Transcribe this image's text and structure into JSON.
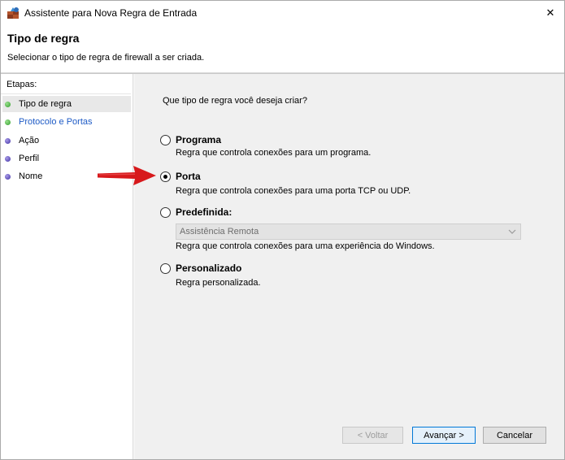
{
  "window": {
    "title": "Assistente para Nova Regra de Entrada",
    "icon": "firewall-app-icon",
    "close_glyph": "✕"
  },
  "header": {
    "title": "Tipo de regra",
    "subtitle": "Selecionar o tipo de regra de firewall a ser criada."
  },
  "sidebar": {
    "heading": "Etapas:",
    "steps": [
      {
        "label": "Tipo de regra",
        "status": "done",
        "active": true
      },
      {
        "label": "Protocolo e Portas",
        "status": "done",
        "active": false
      },
      {
        "label": "Ação",
        "status": "pending",
        "active": false
      },
      {
        "label": "Perfil",
        "status": "pending",
        "active": false
      },
      {
        "label": "Nome",
        "status": "pending",
        "active": false
      }
    ]
  },
  "main": {
    "question": "Que tipo de regra você deseja criar?",
    "options": [
      {
        "label": "Programa",
        "description": "Regra que controla conexões para um programa.",
        "selected": false
      },
      {
        "label": "Porta",
        "description": "Regra que controla conexões para uma porta TCP ou UDP.",
        "selected": true
      },
      {
        "label": "Predefinida:",
        "description": "Regra que controla conexões para uma experiência do Windows.",
        "selected": false
      },
      {
        "label": "Personalizado",
        "description": "Regra personalizada.",
        "selected": false
      }
    ],
    "predefined_select": {
      "value": "Assistência Remota",
      "disabled": true
    }
  },
  "buttons": {
    "back": "< Voltar",
    "next": "Avançar >",
    "cancel": "Cancelar"
  },
  "annotation": {
    "icon": "red-arrow-icon",
    "color": "#d7191c"
  },
  "colors": {
    "accent": "#0078d7",
    "step_done": "#2f9d2a",
    "step_pending": "#3e2fa3",
    "link": "#1e5bc6"
  }
}
